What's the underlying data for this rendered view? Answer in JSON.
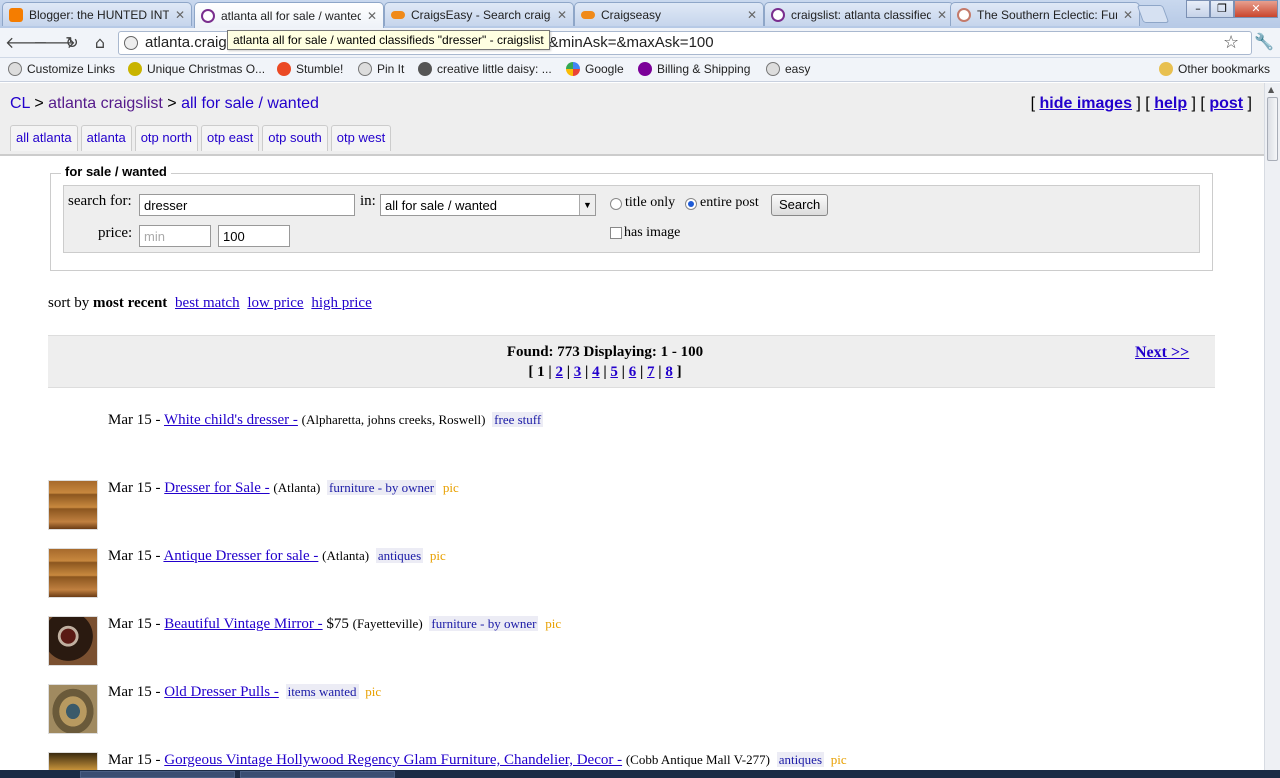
{
  "browser": {
    "tabs": [
      {
        "title": "Blogger: the HUNTED INTI",
        "icon": "blogger-icon",
        "active": false
      },
      {
        "title": "atlanta all for sale / wanted",
        "icon": "peace-icon",
        "active": true
      },
      {
        "title": "CraigsEasy - Search craigsl",
        "icon": "craigseasy-icon",
        "active": false
      },
      {
        "title": "Craigseasy",
        "icon": "craigseasy-icon",
        "active": false
      },
      {
        "title": "craigslist: atlanta classified",
        "icon": "peace-icon",
        "active": false
      },
      {
        "title": "The Southern Eclectic: Fun",
        "icon": "southern-eclectic-icon",
        "active": false
      }
    ],
    "address": "atlanta.craigslist.org/search/sss?query=dresser&srchType=A&minAsk=&maxAsk=100",
    "tooltip": "atlanta all for sale / wanted classifieds \"dresser\" - craigslist",
    "bookmarks": [
      {
        "label": "Customize Links",
        "icon": "globe-icon"
      },
      {
        "label": "Unique Christmas O...",
        "icon": "pear-icon"
      },
      {
        "label": "Stumble!",
        "icon": "stumbleupon-icon"
      },
      {
        "label": "Pin It",
        "icon": "globe-icon"
      },
      {
        "label": "creative little daisy: ...",
        "icon": "daisy-icon"
      },
      {
        "label": "Google",
        "icon": "google-icon"
      },
      {
        "label": "Billing & Shipping",
        "icon": "yahoo-icon"
      },
      {
        "label": "easy",
        "icon": "globe-icon"
      }
    ],
    "other_bookmarks": "Other bookmarks"
  },
  "header": {
    "breadcrumb": {
      "cl": "CL",
      "sep": ">",
      "city": "atlanta craigslist",
      "section": "all for sale / wanted"
    },
    "links": {
      "hide_images": "hide images",
      "help": "help",
      "post": "post"
    },
    "subareas": [
      "all atlanta",
      "atlanta",
      "otp north",
      "otp east",
      "otp south",
      "otp west"
    ]
  },
  "search": {
    "legend": "for sale / wanted",
    "search_for_label": "search for:",
    "query": "dresser",
    "in_label": "in:",
    "category": "all for sale / wanted",
    "title_only": "title only",
    "entire_post": "entire post",
    "search_button": "Search",
    "price_label": "price:",
    "min_placeholder": "min",
    "max_value": "100",
    "has_image": "has image"
  },
  "sort": {
    "prefix": "sort by",
    "current": "most recent",
    "options": [
      "best match",
      "low price",
      "high price"
    ]
  },
  "results": {
    "found": "Found: 773 Displaying: 1 - 100",
    "current_page": "1",
    "pages": [
      "2",
      "3",
      "4",
      "5",
      "6",
      "7",
      "8"
    ],
    "next": "Next >>"
  },
  "listings": [
    {
      "date": "Mar 15 -",
      "title": "White child's dresser -",
      "price": "",
      "location": "(Alpharetta, johns creeks, Roswell)",
      "category": "free stuff",
      "pic": "",
      "thumb": "none"
    },
    {
      "date": "Mar 15 -",
      "title": "Dresser for Sale -",
      "price": "",
      "location": "(Atlanta)",
      "category": "furniture - by owner",
      "pic": "pic",
      "thumb": "dresser"
    },
    {
      "date": "Mar 15 -",
      "title": "Antique Dresser for sale -",
      "price": "",
      "location": "(Atlanta)",
      "category": "antiques",
      "pic": "pic",
      "thumb": "dresser"
    },
    {
      "date": "Mar 15 -",
      "title": "Beautiful Vintage Mirror -",
      "price": "$75",
      "location": "(Fayetteville)",
      "category": "furniture - by owner",
      "pic": "pic",
      "thumb": "mirror"
    },
    {
      "date": "Mar 15 -",
      "title": "Old Dresser Pulls -",
      "price": "",
      "location": "",
      "category": "items wanted",
      "pic": "pic",
      "thumb": "pulls"
    },
    {
      "date": "Mar 15 -",
      "title": "Gorgeous Vintage Hollywood Regency Glam Furniture, Chandelier, Decor -",
      "price": "",
      "location": "(Cobb Antique Mall V-277)",
      "category": "antiques",
      "pic": "pic",
      "thumb": "gorgeous"
    }
  ]
}
